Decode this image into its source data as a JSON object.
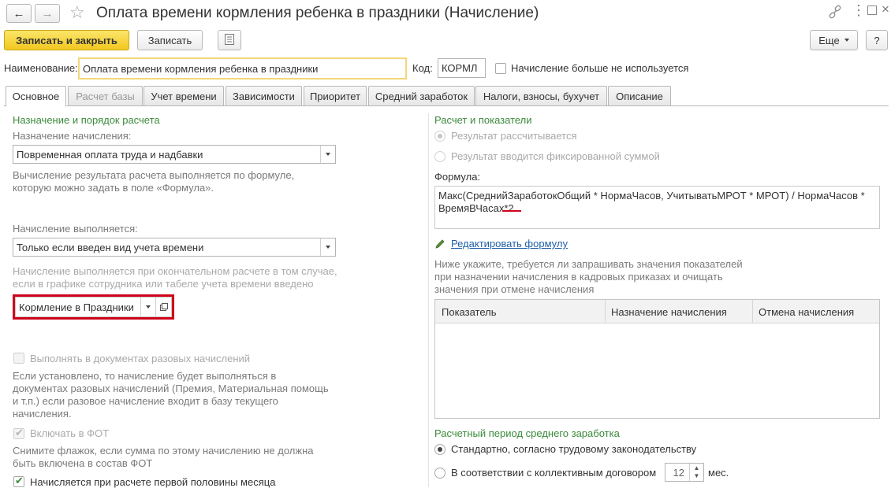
{
  "window": {
    "title": "Оплата времени кормления ребенка в праздники (Начисление)"
  },
  "toolbar": {
    "save_close": "Записать и закрыть",
    "save": "Записать",
    "more": "Еще",
    "help": "?"
  },
  "header": {
    "name_label": "Наименование:",
    "name_value": "Оплата времени кормления ребенка в праздники",
    "code_label": "Код:",
    "code_value": "КОРМЛ",
    "unused_label": "Начисление больше не используется"
  },
  "tabs": [
    {
      "label": "Основное"
    },
    {
      "label": "Расчет базы"
    },
    {
      "label": "Учет времени"
    },
    {
      "label": "Зависимости"
    },
    {
      "label": "Приоритет"
    },
    {
      "label": "Средний заработок"
    },
    {
      "label": "Налоги, взносы, бухучет"
    },
    {
      "label": "Описание"
    }
  ],
  "left": {
    "section_title": "Назначение и порядок расчета",
    "purpose_label": "Назначение начисления:",
    "purpose_value": "Повременная оплата труда и надбавки",
    "purpose_hint_1": "Вычисление результата расчета выполняется по формуле,",
    "purpose_hint_2": "которую можно задать в поле «Формула».",
    "performed_label": "Начисление выполняется:",
    "performed_value": "Только если введен вид учета времени",
    "performed_hint_1": "Начисление выполняется при окончательном расчете в том случае,",
    "performed_hint_2": "если в графике сотрудника или табеле учета времени введено",
    "time_type_value": "Кормление в Праздники",
    "one_time_label": "Выполнять в документах разовых начислений",
    "one_time_hint_1": "Если установлено, то начисление будет выполняться в",
    "one_time_hint_2": "документах разовых начислений (Премия, Материальная помощь",
    "one_time_hint_3": "и т.п.) если разовое начисление входит в базу текущего",
    "one_time_hint_4": "начисления.",
    "fot_label": "Включать в ФОТ",
    "fot_hint_1": "Снимите флажок, если сумма по этому начислению не должна",
    "fot_hint_2": "быть включена в состав ФОТ",
    "first_half_label": "Начисляется при расчете первой половины месяца"
  },
  "right": {
    "section_title": "Расчет и показатели",
    "radio_calc": "Результат рассчитывается",
    "radio_fixed": "Результат вводится фиксированной суммой",
    "formula_label": "Формула:",
    "formula_line_1": "Макс(СреднийЗаработокОбщий * НормаЧасов, УчитыватьМРОТ * МРОТ) / НормаЧасов *",
    "formula_line_2_a": "ВремяВЧасах",
    "formula_line_2_b": "*2",
    "edit_formula_link": "Редактировать формулу",
    "indicators_hint_1": "Ниже укажите, требуется ли запрашивать значения показателей",
    "indicators_hint_2": "при назначении начисления в кадровых приказах и очищать",
    "indicators_hint_3": "значения при отмене начисления",
    "table": {
      "columns": [
        "Показатель",
        "Назначение начисления",
        "Отмена начисления"
      ]
    },
    "avg_period_title": "Расчетный период среднего заработка",
    "radio_standard": "Стандартно, согласно трудовому законодательству",
    "radio_collective": "В соответствии с коллективным договором",
    "months_value": "12",
    "months_unit": "мес."
  },
  "colors": {
    "accent_yellow": "#f2c820",
    "section_green": "#3b8a3b",
    "highlight_red": "#d0021b",
    "link_blue": "#1f5fa8"
  }
}
